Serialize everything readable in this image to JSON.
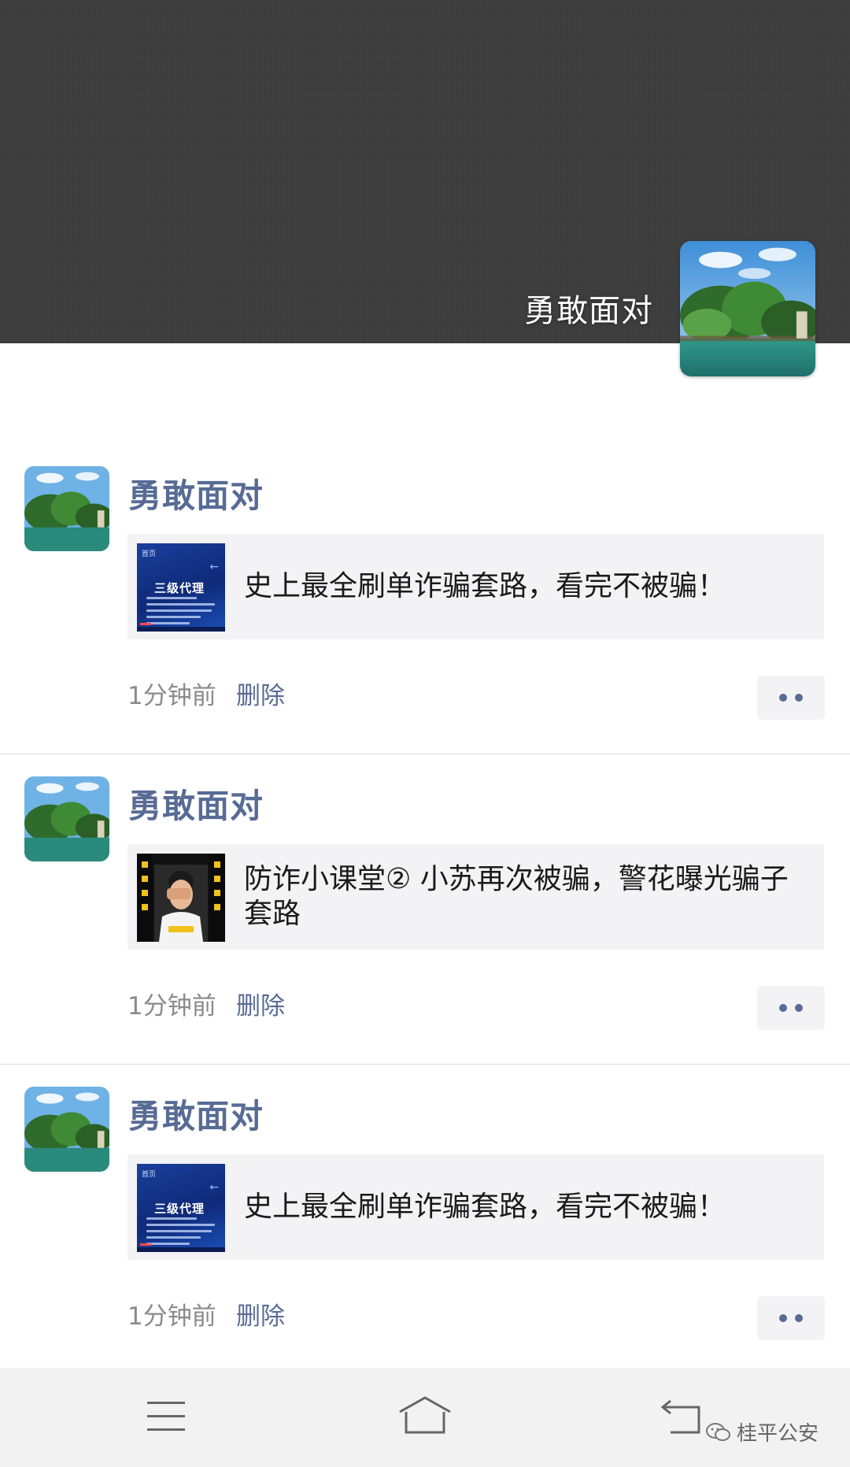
{
  "profile": {
    "name": "勇敢面对"
  },
  "posts": [
    {
      "author": "勇敢面对",
      "link_title": "史上最全刷单诈骗套路，看完不被骗！",
      "thumb_style": "blue-slide",
      "time": "1分钟前",
      "delete_label": "删除"
    },
    {
      "author": "勇敢面对",
      "link_title": "防诈小课堂② 小苏再次被骗，警花曝光骗子套路",
      "thumb_style": "dark-person",
      "time": "1分钟前",
      "delete_label": "删除"
    },
    {
      "author": "勇敢面对",
      "link_title": "史上最全刷单诈骗套路，看完不被骗！",
      "thumb_style": "blue-slide",
      "time": "1分钟前",
      "delete_label": "删除"
    }
  ],
  "thumb_text": {
    "blue_top": "首页",
    "blue_head": "三级代理"
  },
  "bottom_nav": {
    "items": [
      "menu-icon",
      "home-icon",
      "back-icon"
    ]
  },
  "watermark": {
    "text": "桂平公安"
  },
  "colors": {
    "cover_bg": "#3d3d3d",
    "link_blue": "#576b95",
    "card_bg": "#f3f3f5",
    "nav_bg": "#f2f2f2"
  }
}
